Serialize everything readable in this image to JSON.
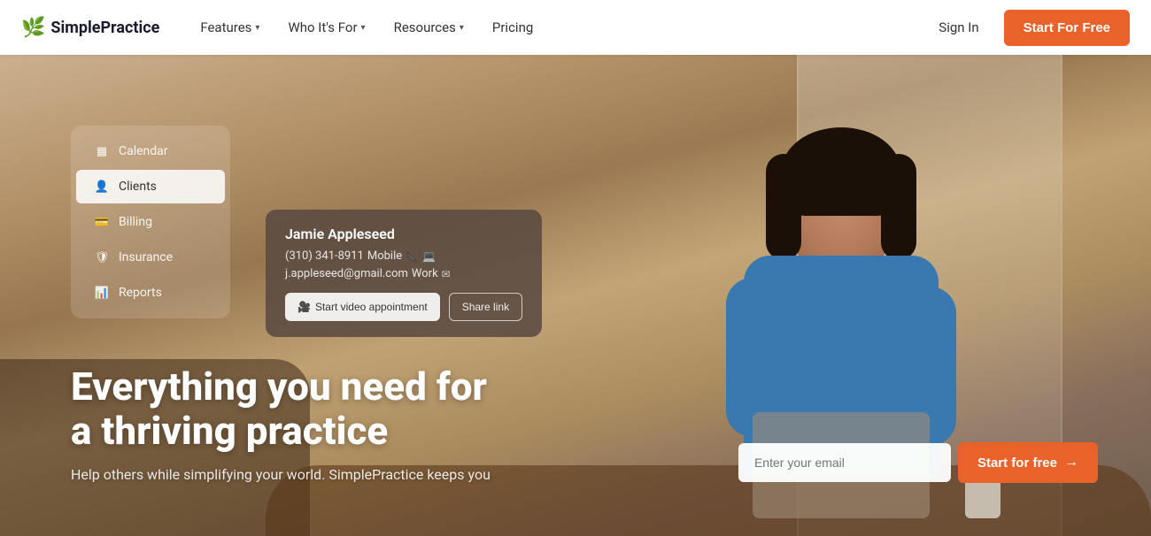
{
  "brand": {
    "name": "SimplePractice",
    "logo_icon": "🌿"
  },
  "navbar": {
    "links": [
      {
        "id": "features",
        "label": "Features",
        "has_dropdown": true
      },
      {
        "id": "who-its-for",
        "label": "Who It's For",
        "has_dropdown": true
      },
      {
        "id": "resources",
        "label": "Resources",
        "has_dropdown": true
      },
      {
        "id": "pricing",
        "label": "Pricing",
        "has_dropdown": false
      }
    ],
    "sign_in_label": "Sign In",
    "start_btn_label": "Start For Free"
  },
  "ui_panel": {
    "items": [
      {
        "id": "calendar",
        "label": "Calendar",
        "icon": "▦",
        "active": false
      },
      {
        "id": "clients",
        "label": "Clients",
        "icon": "👤",
        "active": true
      },
      {
        "id": "billing",
        "label": "Billing",
        "icon": "💳",
        "active": false
      },
      {
        "id": "insurance",
        "label": "Insurance",
        "icon": "🛡",
        "active": false
      },
      {
        "id": "reports",
        "label": "Reports",
        "icon": "📊",
        "active": false
      }
    ]
  },
  "client_card": {
    "name": "Jamie Appleseed",
    "phone": "(310) 341-8911",
    "phone_label": "Mobile",
    "email": "j.appleseed@gmail.com",
    "email_label": "Work",
    "btn_video": "Start video appointment",
    "btn_share": "Share link"
  },
  "hero": {
    "headline_line1": "Everything you need for",
    "headline_line2": "a thriving practice",
    "subtext": "Help others while simplifying your world. SimplePractice keeps you"
  },
  "email_cta": {
    "placeholder": "Enter your email",
    "btn_label": "Start for free"
  }
}
